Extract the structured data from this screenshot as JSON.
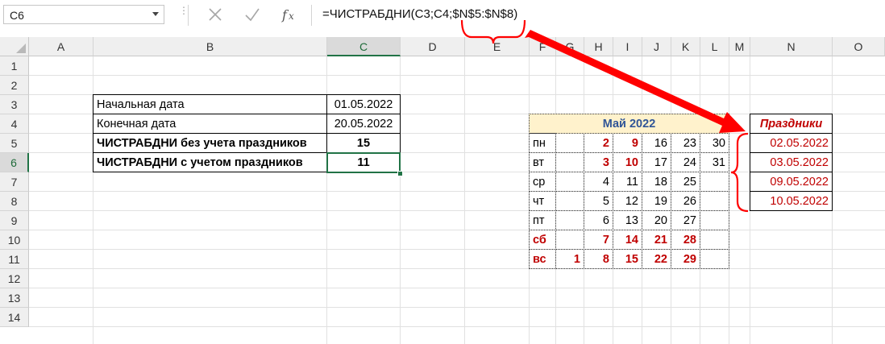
{
  "name_box": "C6",
  "formula": "=ЧИСТРАБДНИ(C3;C4;$N$5:$N$8)",
  "columns": [
    "A",
    "B",
    "C",
    "D",
    "E",
    "F",
    "G",
    "H",
    "I",
    "J",
    "K",
    "L",
    "M",
    "N",
    "O"
  ],
  "rows": [
    "1",
    "2",
    "3",
    "4",
    "5",
    "6",
    "7",
    "8",
    "9",
    "10",
    "11",
    "12",
    "13",
    "14"
  ],
  "selected_cell": {
    "column": "C",
    "row": "6"
  },
  "main_table": [
    {
      "label": "Начальная дата",
      "value": "01.05.2022"
    },
    {
      "label": "Конечная дата",
      "value": "20.05.2022"
    },
    {
      "label": "ЧИСТРАБДНИ без учета праздников",
      "value": "15"
    },
    {
      "label": "ЧИСТРАБДНИ с учетом праздников",
      "value": "11"
    }
  ],
  "calendar": {
    "title": "Май 2022",
    "rows": [
      {
        "day": "пн",
        "weekend": false,
        "cells": [
          "",
          "2",
          "9",
          "16",
          "23",
          "30"
        ],
        "red": [
          false,
          true,
          true,
          false,
          false,
          false
        ]
      },
      {
        "day": "вт",
        "weekend": false,
        "cells": [
          "",
          "3",
          "10",
          "17",
          "24",
          "31"
        ],
        "red": [
          false,
          true,
          true,
          false,
          false,
          false
        ]
      },
      {
        "day": "ср",
        "weekend": false,
        "cells": [
          "",
          "4",
          "11",
          "18",
          "25",
          ""
        ],
        "red": [
          false,
          false,
          false,
          false,
          false,
          false
        ]
      },
      {
        "day": "чт",
        "weekend": false,
        "cells": [
          "",
          "5",
          "12",
          "19",
          "26",
          ""
        ],
        "red": [
          false,
          false,
          false,
          false,
          false,
          false
        ]
      },
      {
        "day": "пт",
        "weekend": false,
        "cells": [
          "",
          "6",
          "13",
          "20",
          "27",
          ""
        ],
        "red": [
          false,
          false,
          false,
          false,
          false,
          false
        ]
      },
      {
        "day": "сб",
        "weekend": true,
        "cells": [
          "",
          "7",
          "14",
          "21",
          "28",
          ""
        ],
        "red": [
          false,
          true,
          true,
          true,
          true,
          false
        ]
      },
      {
        "day": "вс",
        "weekend": true,
        "cells": [
          "1",
          "8",
          "15",
          "22",
          "29",
          ""
        ],
        "red": [
          true,
          true,
          true,
          true,
          true,
          false
        ]
      }
    ]
  },
  "holidays": {
    "title": "Праздники",
    "dates": [
      "02.05.2022",
      "03.05.2022",
      "09.05.2022",
      "10.05.2022"
    ]
  },
  "colors": {
    "accent": "#217346",
    "holiday_red": "#c00000",
    "annotation_red": "#ff0000",
    "calendar_header": "#fff2cc"
  }
}
